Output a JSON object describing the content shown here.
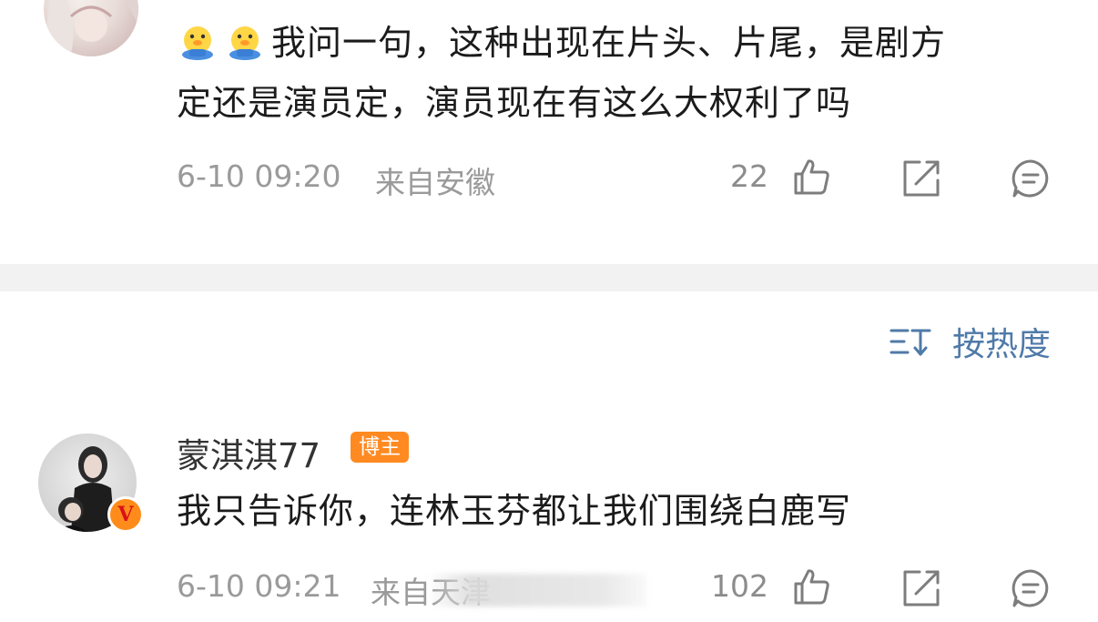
{
  "comment1": {
    "text_line1": "我问一句，这种出现在片头、片尾，是剧方",
    "text_line2": "定还是演员定，演员现在有这么大权利了吗",
    "emojis": [
      "chick-emoji",
      "chick-emoji"
    ],
    "timestamp": "6-10 09:20",
    "location": "来自安徽",
    "like_count": "22"
  },
  "sort": {
    "icon": "sort-icon",
    "label": "按热度"
  },
  "comment2": {
    "username": "蒙淇淇77",
    "badge": "博主",
    "verified_badge": "V",
    "text": "我只告诉你，连林玉芬都让我们围绕白鹿写",
    "timestamp": "6-10 09:21",
    "location": "来自天津",
    "like_count": "102"
  },
  "colors": {
    "accent_link": "#4f7aa8",
    "meta_gray": "#9a9a9a",
    "author_badge": "#ff8a22",
    "divider": "#f2f2f2"
  }
}
